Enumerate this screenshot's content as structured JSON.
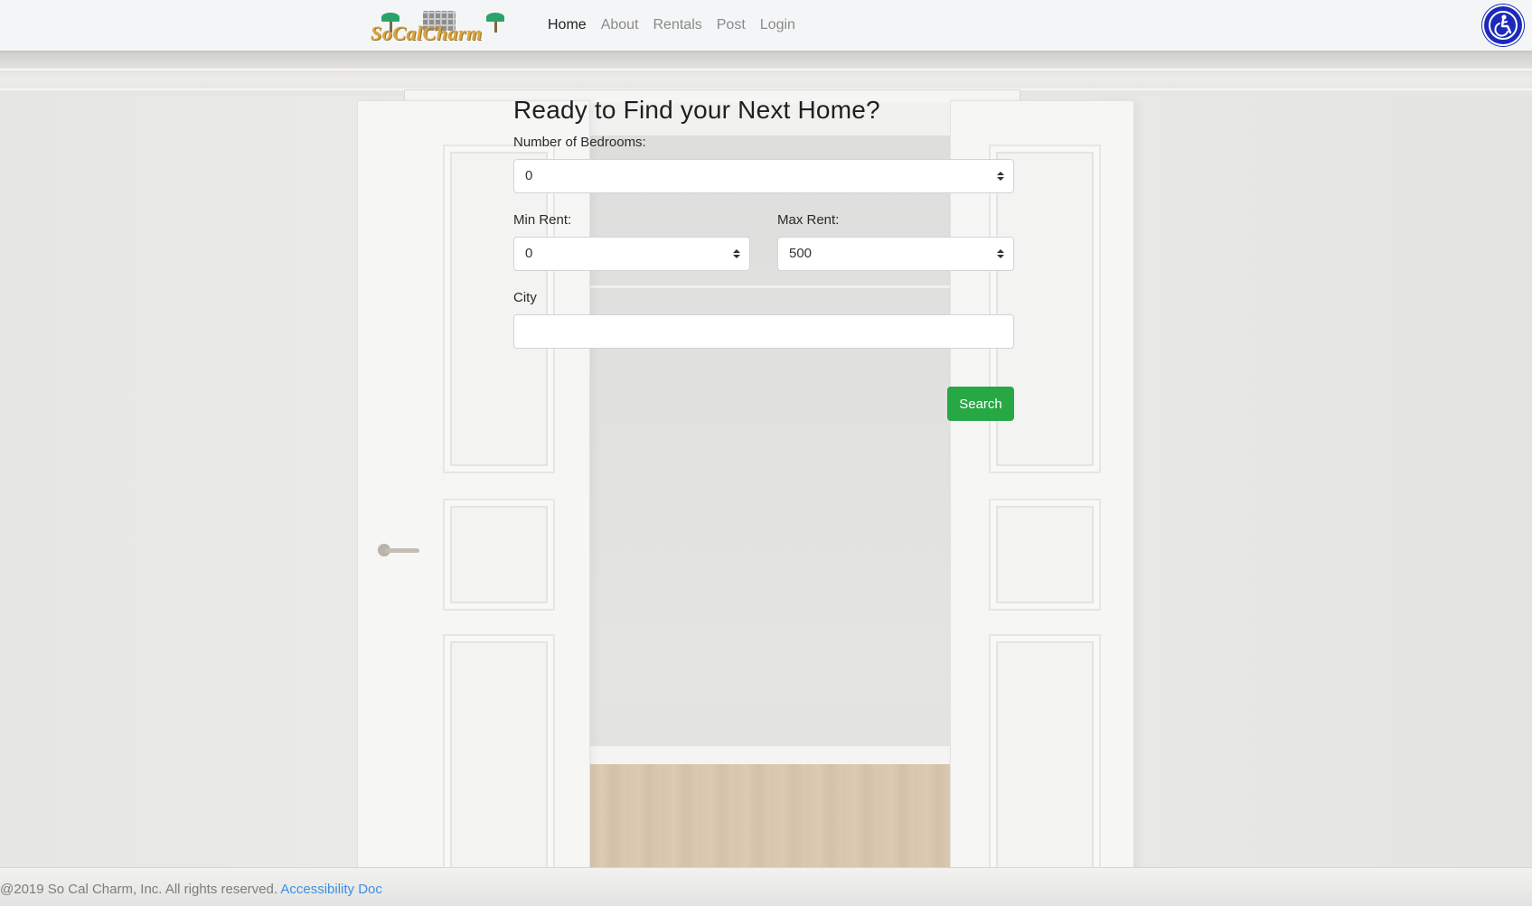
{
  "brand": {
    "logo_text": "SoCalCharm"
  },
  "nav": {
    "items": [
      {
        "label": "Home",
        "active": true
      },
      {
        "label": "About"
      },
      {
        "label": "Rentals"
      },
      {
        "label": "Post"
      },
      {
        "label": "Login"
      }
    ]
  },
  "accessibility": {
    "icon": "accessibility-icon",
    "color": "#1b2ab8"
  },
  "form": {
    "title": "Ready to Find your Next Home?",
    "bedrooms": {
      "label": "Number of Bedrooms:",
      "value": "0"
    },
    "min_rent": {
      "label": "Min Rent:",
      "value": "0"
    },
    "max_rent": {
      "label": "Max Rent:",
      "value": "500"
    },
    "city": {
      "label": "City",
      "value": ""
    },
    "search_label": "Search",
    "search_color": "#28a745"
  },
  "footer": {
    "copyright": "@2019 So Cal Charm, Inc. All rights reserved.",
    "link_label": "Accessibility Doc",
    "link_color": "#3d8fe0"
  }
}
